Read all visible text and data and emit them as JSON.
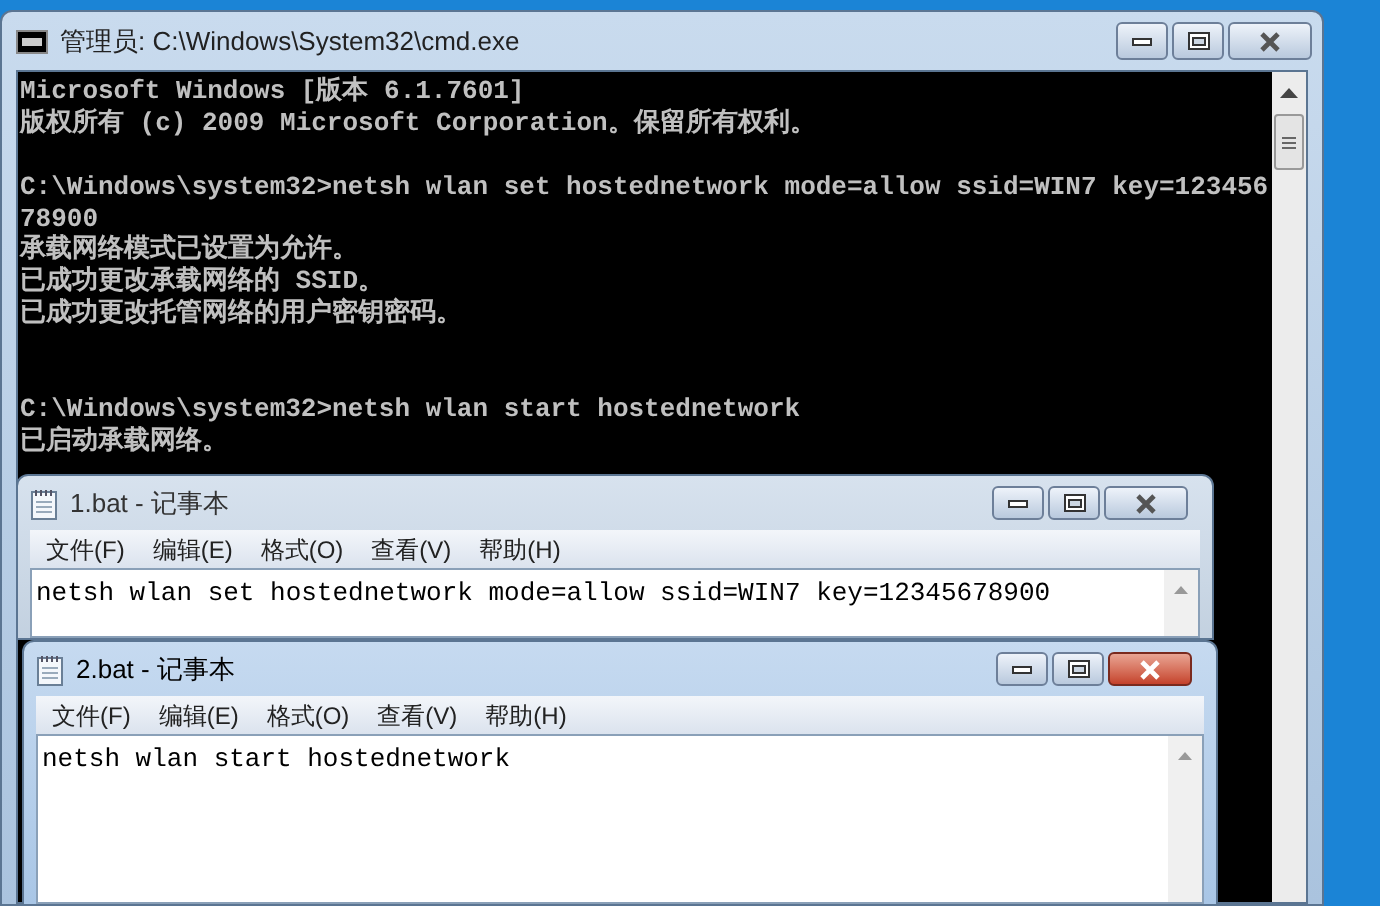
{
  "console_window": {
    "title": "管理员: C:\\Windows\\System32\\cmd.exe",
    "active": false,
    "lines": [
      {
        "kind": "text",
        "text": "Microsoft Windows [版本 6.1.7601]"
      },
      {
        "kind": "text",
        "text": "版权所有 (c) 2009 Microsoft Corporation。保留所有权利。"
      },
      {
        "kind": "blank"
      },
      {
        "kind": "text",
        "text": "C:\\Windows\\system32>netsh wlan set hostednetwork mode=allow ssid=WIN7 key=123456"
      },
      {
        "kind": "text",
        "text": "78900"
      },
      {
        "kind": "text",
        "text": "承载网络模式已设置为允许。"
      },
      {
        "kind": "text",
        "text": "已成功更改承载网络的 SSID。"
      },
      {
        "kind": "text",
        "text": "已成功更改托管网络的用户密钥密码。"
      },
      {
        "kind": "blank"
      },
      {
        "kind": "blank"
      },
      {
        "kind": "text",
        "text": "C:\\Windows\\system32>netsh wlan start hostednetwork"
      },
      {
        "kind": "text",
        "text": "已启动承载网络。"
      }
    ]
  },
  "notepads": [
    {
      "title": "1.bat - 记事本",
      "active": false,
      "menu": [
        "文件(F)",
        "编辑(E)",
        "格式(O)",
        "查看(V)",
        "帮助(H)"
      ],
      "text": "netsh wlan set hostednetwork mode=allow ssid=WIN7 key=12345678900"
    },
    {
      "title": "2.bat - 记事本",
      "active": true,
      "menu": [
        "文件(F)",
        "编辑(E)",
        "格式(O)",
        "查看(V)",
        "帮助(H)"
      ],
      "text": "netsh wlan start hostednetwork"
    }
  ]
}
